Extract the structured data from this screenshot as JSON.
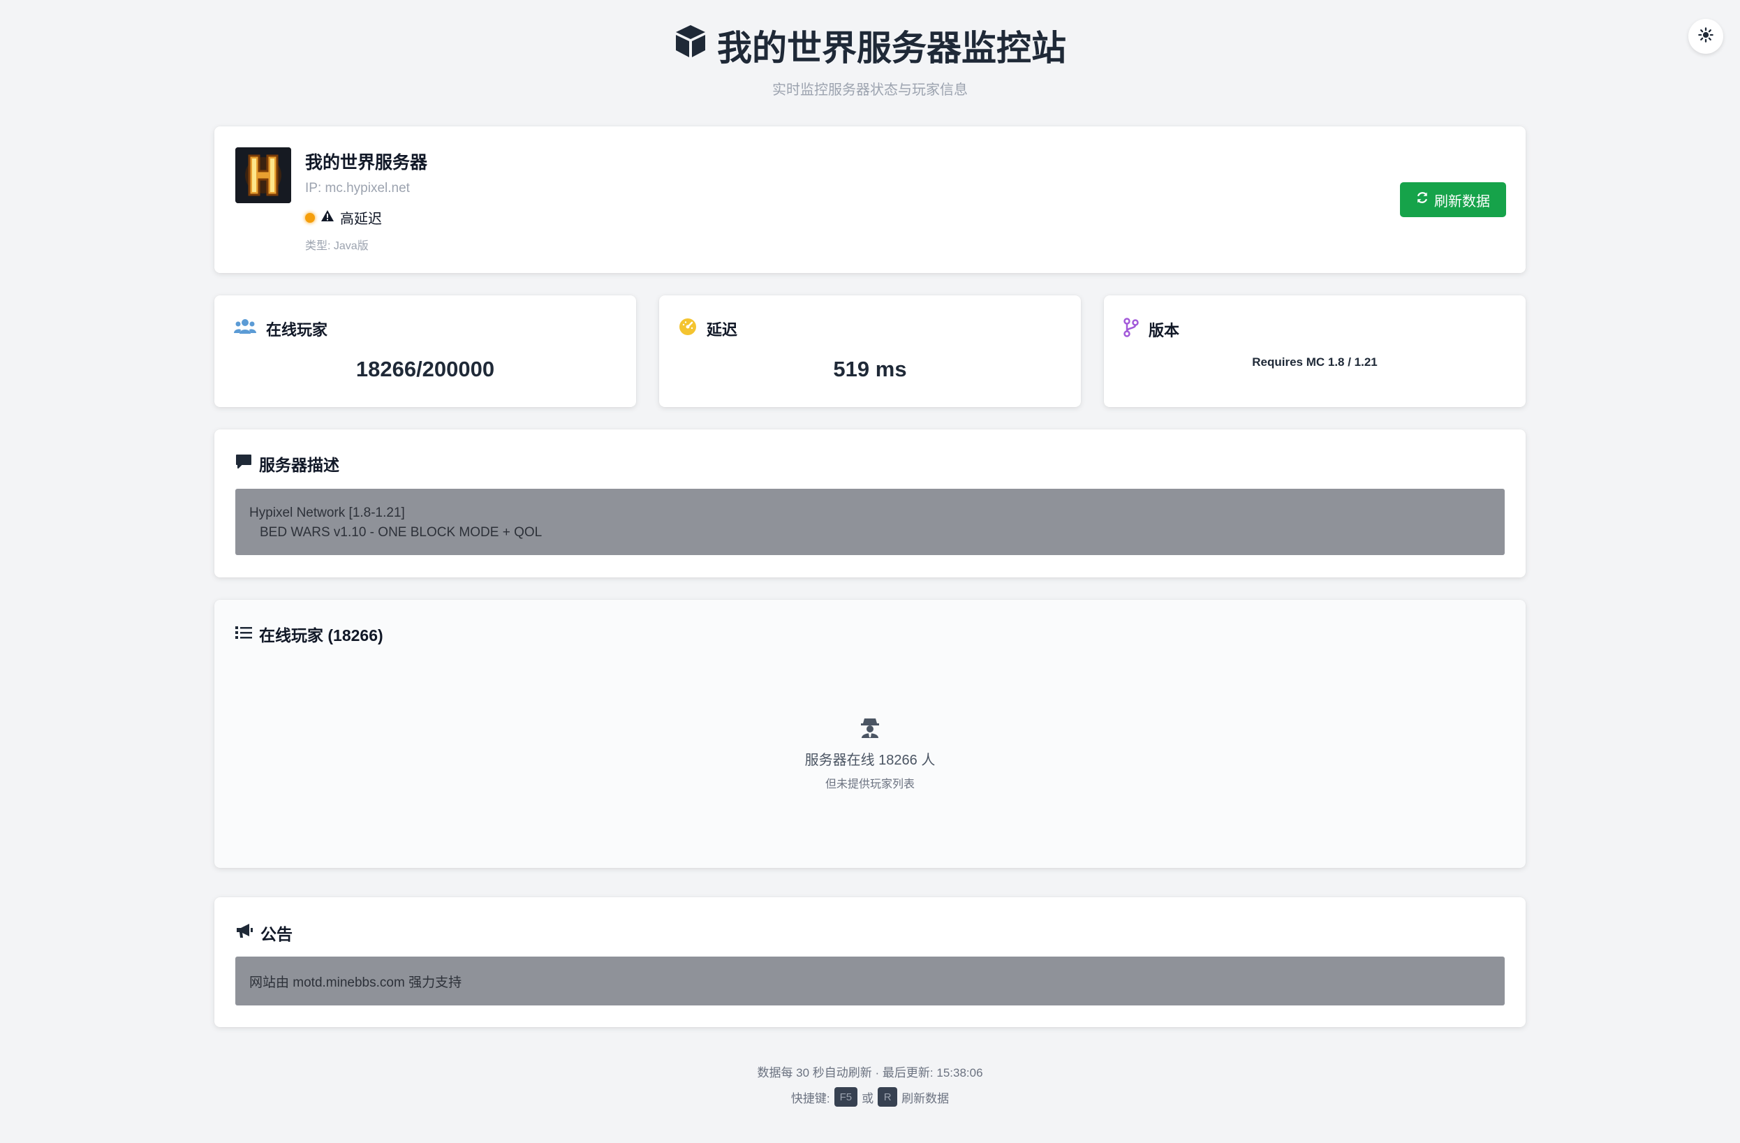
{
  "header": {
    "icon": "cube-icon",
    "title": "我的世界服务器监控站",
    "subtitle": "实时监控服务器状态与玩家信息"
  },
  "theme_toggle": {
    "icon": "sun-icon"
  },
  "server": {
    "name": "我的世界服务器",
    "ip": "IP: mc.hypixel.net",
    "status": "高延迟",
    "status_color": "#f59e0b",
    "type": "类型: Java版",
    "refresh_label": "刷新数据"
  },
  "stats": {
    "players": {
      "label": "在线玩家",
      "value": "18266/200000",
      "icon": "users-icon"
    },
    "latency": {
      "label": "延迟",
      "value": "519 ms",
      "icon": "gauge-icon"
    },
    "version": {
      "label": "版本",
      "value": "Requires MC 1.8 / 1.21",
      "icon": "code-branch-icon"
    }
  },
  "description": {
    "title": "服务器描述",
    "line1": "Hypixel Network [1.8-1.21]",
    "line2": "BED WARS v1.10 - ONE BLOCK MODE + QOL"
  },
  "player_list": {
    "title": "在线玩家 (18266)",
    "empty_line1": "服务器在线 18266 人",
    "empty_line2": "但未提供玩家列表"
  },
  "notice": {
    "title": "公告",
    "text": "网站由 motd.minebbs.com 强力支持"
  },
  "footer": {
    "line1": "数据每 30 秒自动刷新 · 最后更新:  15:38:06",
    "shortcut_label": "快捷键:",
    "key1": "F5",
    "or": "或",
    "key2": "R",
    "shortcut_action": "刷新数据"
  },
  "colors": {
    "accent_green": "#16a34a",
    "warning_orange": "#f59e0b",
    "panel_gray": "#8f9299"
  }
}
